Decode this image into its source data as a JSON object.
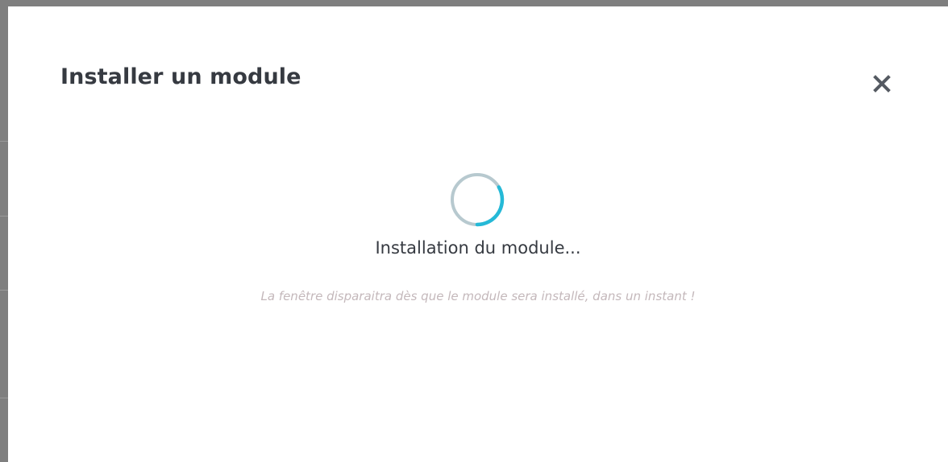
{
  "modal": {
    "title": "Installer un module",
    "close_icon": "close-icon",
    "spinner_icon": "loading-spinner-icon",
    "status": "Installation du module...",
    "hint": "La fenêtre disparaitra dès que le module sera installé, dans un instant !"
  },
  "colors": {
    "title": "#363a41",
    "spinner_track": "#b7c9cf",
    "spinner_arc": "#25b9d7",
    "hint": "#c4b8bb"
  }
}
